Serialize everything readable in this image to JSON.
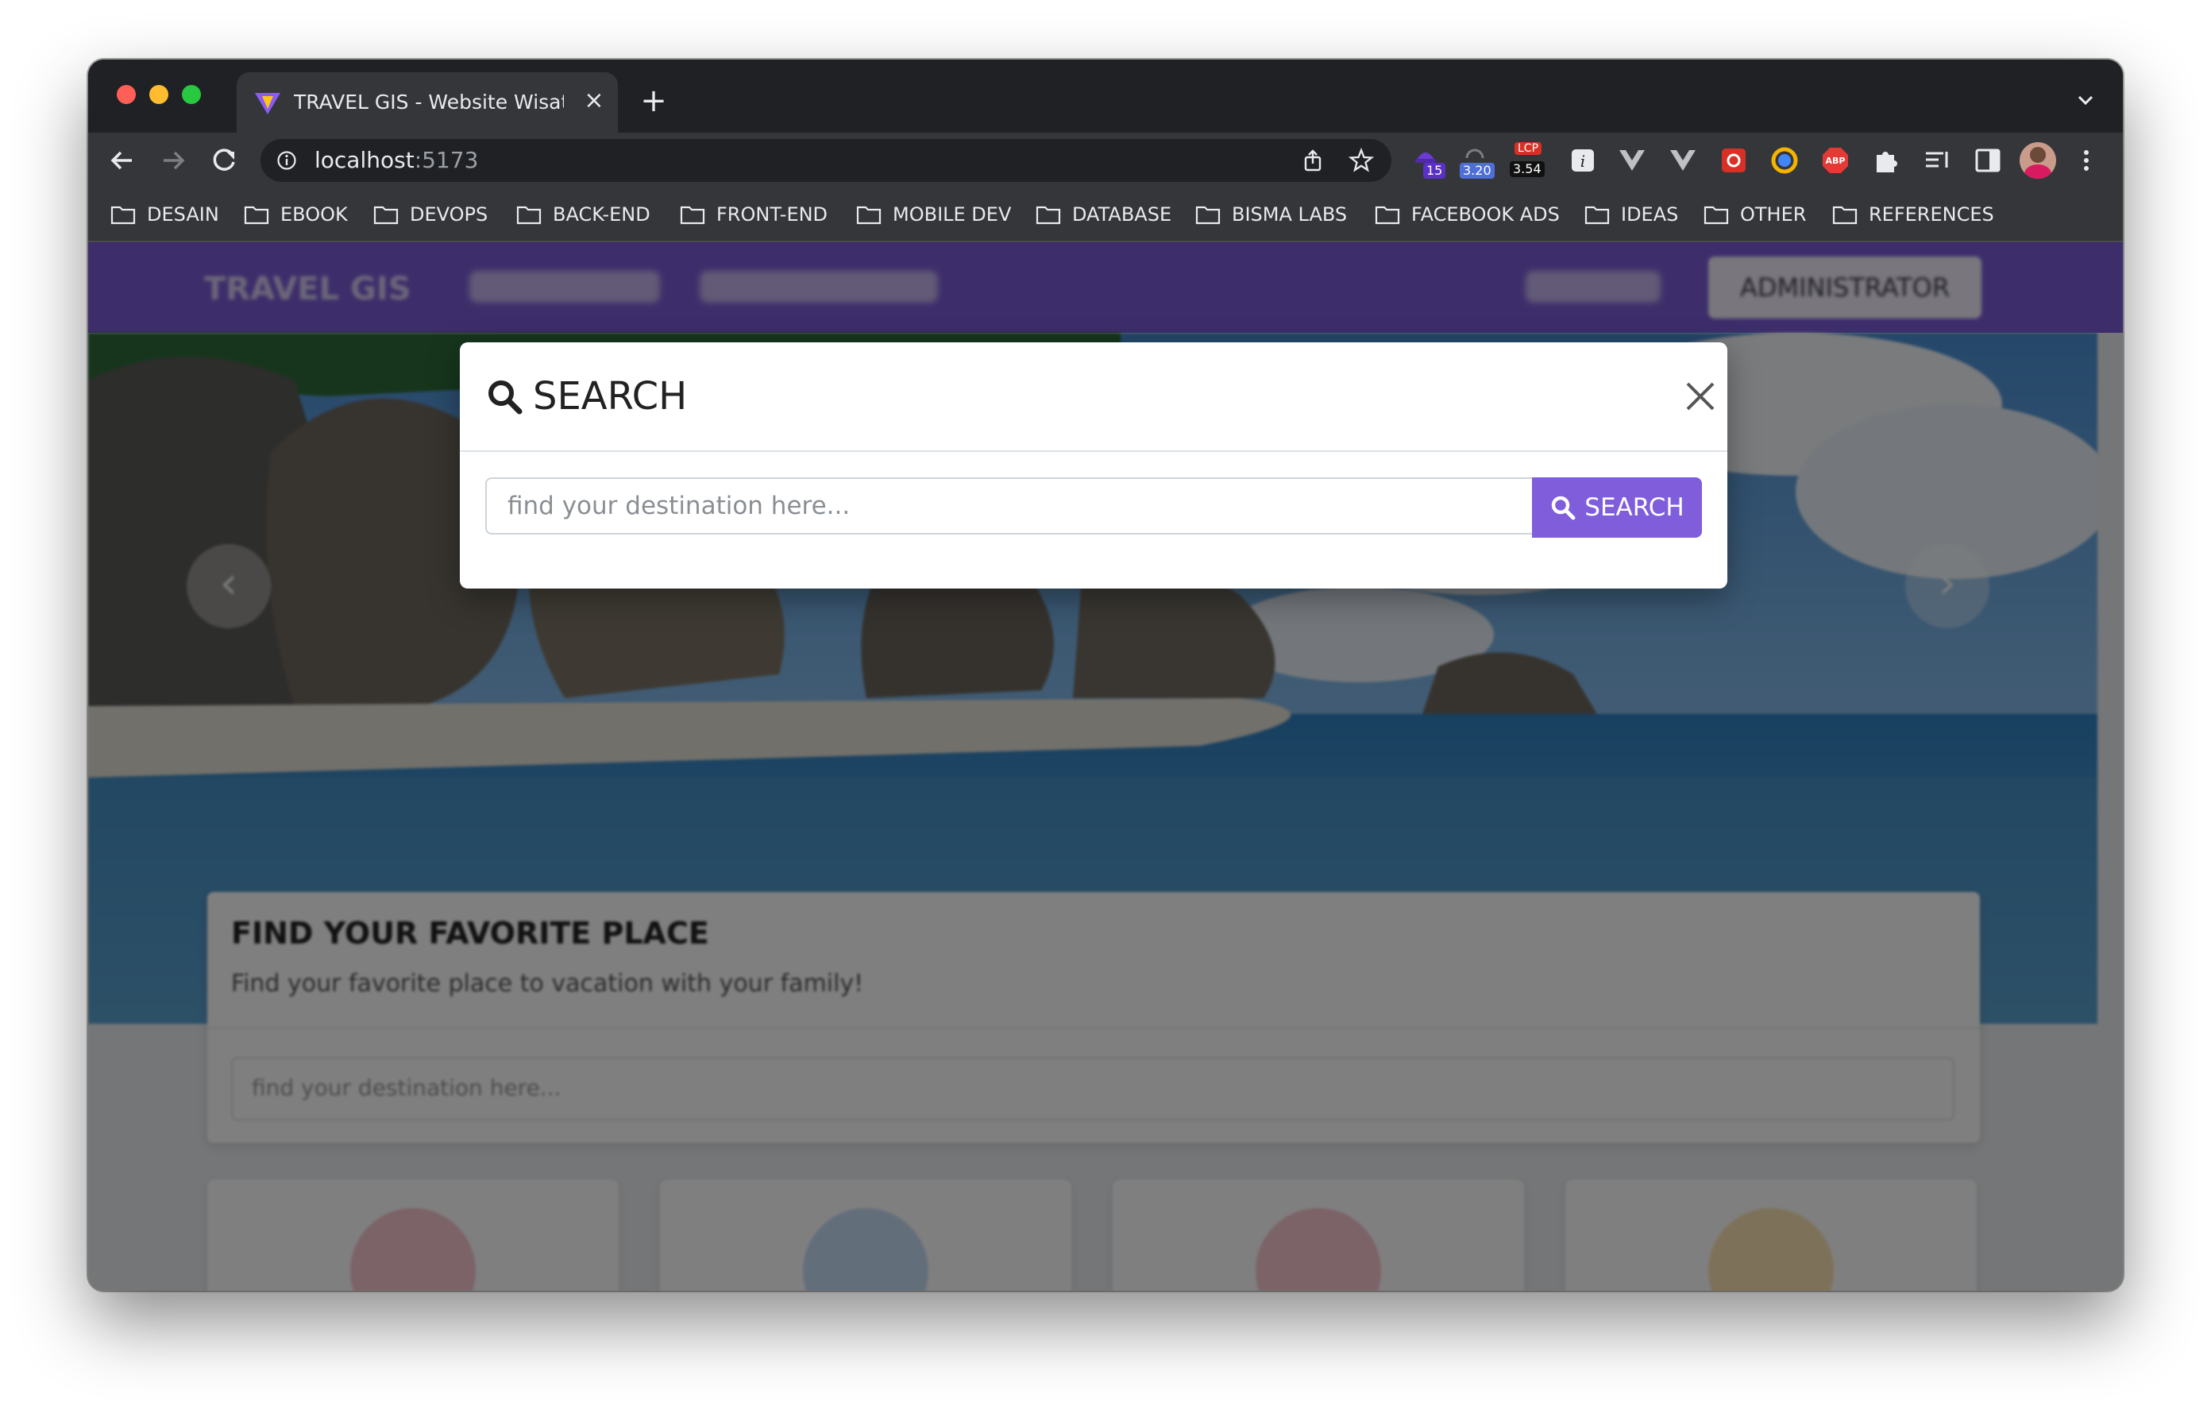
{
  "browser": {
    "tab_title": "TRAVEL GIS - Website Wisata I",
    "url_host": "localhost",
    "url_port": ":5173",
    "extensions": [
      {
        "name": "hat-extension-icon",
        "badge": "15"
      },
      {
        "name": "speed-extension-icon",
        "badge": "3.20"
      },
      {
        "name": "lcp-extension-icon",
        "label": "LCP",
        "badge": "3.54"
      }
    ],
    "bookmarks": [
      "DESAIN",
      "EBOOK",
      "DEVOPS",
      "BACK-END",
      "FRONT-END",
      "MOBILE DEV",
      "DATABASE",
      "BISMA LABS",
      "FACEBOOK ADS",
      "IDEAS",
      "OTHER",
      "REFERENCES"
    ]
  },
  "navbar": {
    "brand": "TRAVEL GIS",
    "admin_button": "ADMINISTRATOR"
  },
  "hero": {
    "prev_arrow": "‹",
    "next_arrow": "›"
  },
  "find_card": {
    "title": "FIND YOUR FAVORITE PLACE",
    "subtitle": "Find your favorite place to vacation with your family!",
    "placeholder": "find your destination here..."
  },
  "modal": {
    "title": "SEARCH",
    "input_placeholder": "find your destination here...",
    "input_value": "",
    "button_label": "SEARCH"
  },
  "colors": {
    "accent": "#7f5ddb",
    "navbar": "#7c5bd6"
  }
}
